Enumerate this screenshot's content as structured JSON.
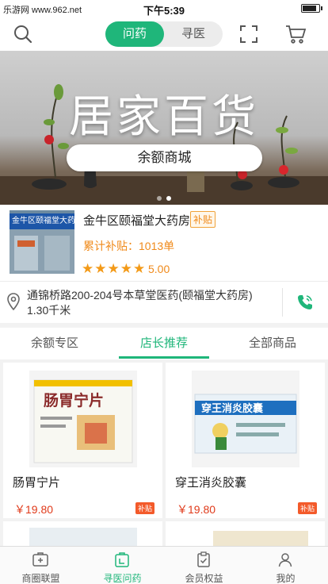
{
  "status_bar": {
    "site": "乐游网 www.962.net",
    "time": "下午5:39"
  },
  "nav": {
    "tab_active": "问药",
    "tab_inactive": "寻医"
  },
  "banner": {
    "title": "居家百货",
    "button": "余额商城"
  },
  "store": {
    "sign_text": "金牛区颐福堂大药",
    "name": "金牛区颐福堂大药房",
    "tag": "补贴",
    "sales": "累计补贴：1013单",
    "stars": "★★★★★",
    "rating": "5.00"
  },
  "address": {
    "line": "通锦桥路200-204号本草堂医药(颐福堂大药房)",
    "distance": "1.30千米"
  },
  "tabs": [
    {
      "label": "余额专区"
    },
    {
      "label": "店长推荐"
    },
    {
      "label": "全部商品"
    }
  ],
  "products": [
    {
      "name": "肠胃宁片",
      "price": "￥19.80",
      "tag": "补贴",
      "box_text": "肠胃宁片"
    },
    {
      "name": "穿王消炎胶囊",
      "price": "￥19.80",
      "tag": "补贴",
      "box_text": "穿王消炎胶囊"
    }
  ],
  "tabbar": [
    {
      "label": "商圈联盟",
      "icon": "medkit-icon"
    },
    {
      "label": "寻医问药",
      "icon": "pharmacy-bag-icon"
    },
    {
      "label": "会员权益",
      "icon": "clipboard-check-icon"
    },
    {
      "label": "我的",
      "icon": "user-icon"
    }
  ],
  "colors": {
    "accent": "#1fb67a",
    "orange": "#f08a1a",
    "price": "#e03a1a"
  }
}
